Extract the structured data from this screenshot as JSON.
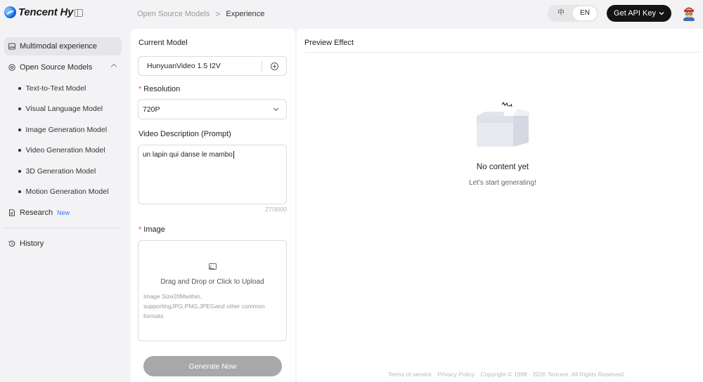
{
  "header": {
    "logo_text": "Tencent Hy",
    "breadcrumb": {
      "parent": "Open Source Models",
      "separator": ">",
      "current": "Experience"
    },
    "lang_options": [
      "中",
      "EN"
    ],
    "api_button_label": "Get API Key"
  },
  "sidebar": {
    "items": [
      {
        "label": "Multimodal experience"
      },
      {
        "label": "Open Source Models"
      },
      {
        "label": "Research",
        "badge": "New"
      },
      {
        "label": "History"
      }
    ],
    "sub_items": [
      "Text-to-Text Model",
      "Visual Language Model",
      "Image Generation Model",
      "Video Generation Model",
      "3D Generation Model",
      "Motion Generation Model"
    ]
  },
  "form": {
    "model_label": "Current Model",
    "model_value": "HunyuanVideo 1.5 I2V",
    "required_mark": "*",
    "resolution_label": "Resolution",
    "resolution_value": "720P",
    "prompt_label": "Video Description (Prompt)",
    "prompt_value": "un lapin qui danse le mambo",
    "prompt_counter": "27/3000",
    "image_label": "Image",
    "upload_title": "Drag and Drop or Click to Upload",
    "upload_hint": "Image Size20Mwithin, supportingJPG,PNG,JPEGand other common formats",
    "generate_label": "Generate Now"
  },
  "preview": {
    "title": "Preview Effect",
    "empty_title": "No content yet",
    "empty_subtitle": "Let's start generating!"
  },
  "footer": {
    "terms": "Terms of service",
    "privacy": "Privacy Policy",
    "copyright": "Copyright © 1998 - 2026 Tencent. All Rights Reserved."
  },
  "colors": {
    "accent_dark": "#141414",
    "badge_blue": "#3478f6",
    "required_red": "#e3493c",
    "disabled_button": "#a8a8ab"
  }
}
